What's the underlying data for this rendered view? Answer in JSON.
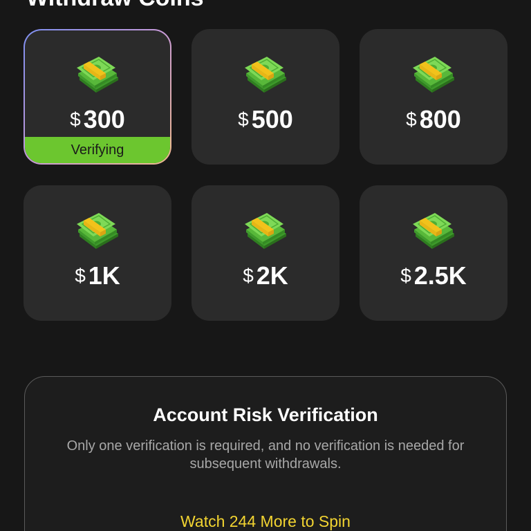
{
  "header": {
    "title": "Withdraw Coins"
  },
  "withdraw_options": [
    {
      "currency": "$",
      "amount": "300",
      "status": "Verifying",
      "selected": true
    },
    {
      "currency": "$",
      "amount": "500"
    },
    {
      "currency": "$",
      "amount": "800"
    },
    {
      "currency": "$",
      "amount": "1K"
    },
    {
      "currency": "$",
      "amount": "2K"
    },
    {
      "currency": "$",
      "amount": "2.5K"
    }
  ],
  "icon": "money-stack-icon",
  "colors": {
    "background": "#171717",
    "card": "#2b2b2b",
    "status_green": "#6cc62f",
    "action_yellow": "#f2d431"
  },
  "verification": {
    "title": "Account Risk Verification",
    "description": "Only one verification is required, and no verification is needed for subsequent withdrawals.",
    "action": "Watch 244 More to Spin"
  }
}
